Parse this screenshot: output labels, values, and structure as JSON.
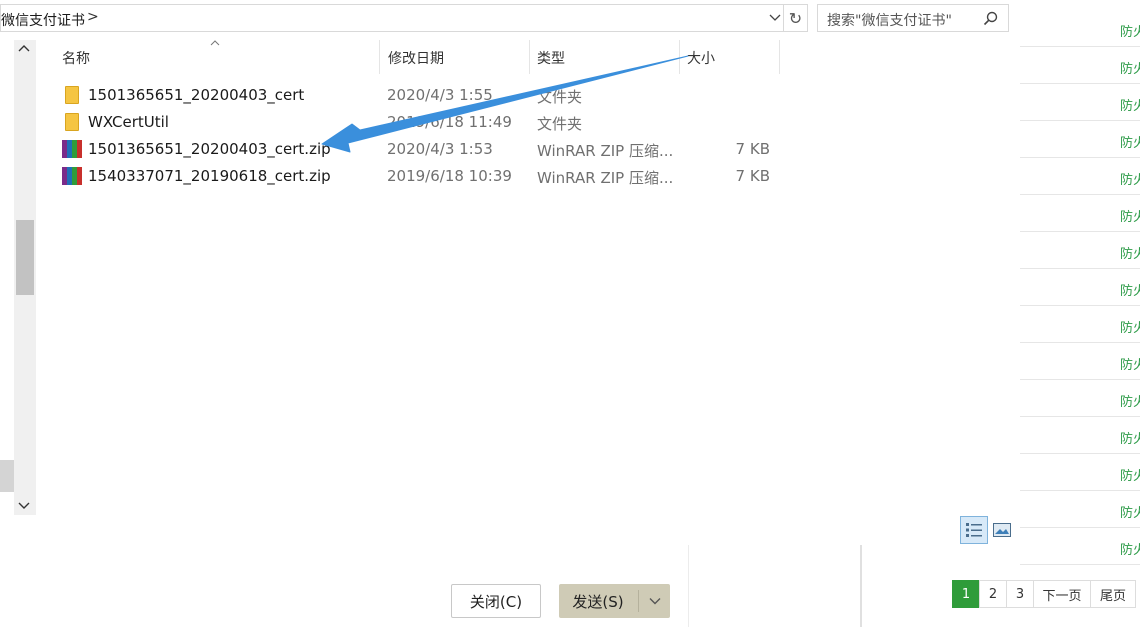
{
  "address_bar": {
    "path": "微信支付证书",
    "separator": ">",
    "dropdown_glyph": "⌵",
    "refresh_glyph": "↻"
  },
  "search": {
    "placeholder": "搜索\"微信支付证书\""
  },
  "columns": {
    "name": "名称",
    "modified": "修改日期",
    "type": "类型",
    "size": "大小"
  },
  "files": [
    {
      "name": "1501365651_20200403_cert",
      "modified": "2020/4/3 1:55",
      "type": "文件夹",
      "size": "",
      "icon": "folder-icon"
    },
    {
      "name": "WXCertUtil",
      "modified": "2019/6/18 11:49",
      "type": "文件夹",
      "size": "",
      "icon": "folder-icon"
    },
    {
      "name": "1501365651_20200403_cert.zip",
      "modified": "2020/4/3 1:53",
      "type": "WinRAR ZIP 压缩...",
      "size": "7 KB",
      "icon": "winrar-zip-icon"
    },
    {
      "name": "1540337071_20190618_cert.zip",
      "modified": "2019/6/18 10:39",
      "type": "WinRAR ZIP 压缩...",
      "size": "7 KB",
      "icon": "winrar-zip-icon"
    }
  ],
  "buttons": {
    "close": "关闭(C)",
    "send": "发送(S)"
  },
  "background_page": {
    "row_label": "防火",
    "row_count": 15,
    "pager": [
      "1",
      "2",
      "3",
      "下一页",
      "尾页"
    ],
    "accent_color": "#2f9c3a"
  },
  "annotation": {
    "color": "#3a8fdc"
  }
}
